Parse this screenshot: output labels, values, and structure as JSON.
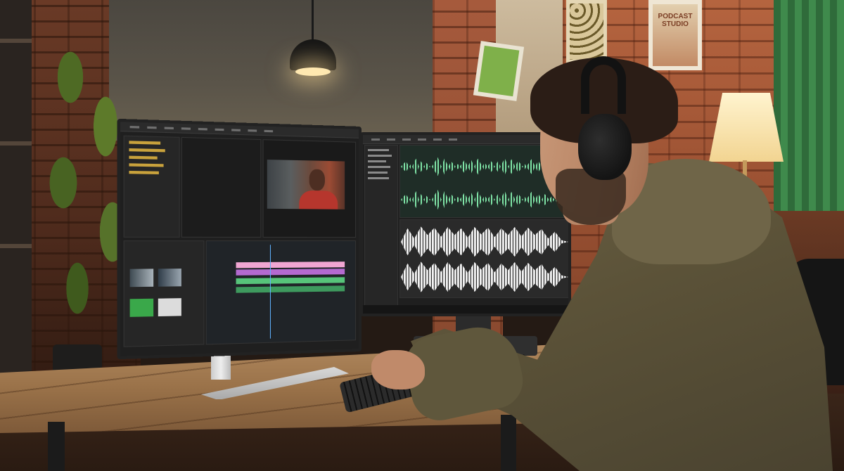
{
  "scene": {
    "poster_text": "PODCAST STUDIO",
    "palette": {
      "brick": "#a65a3c",
      "desk": "#9a7249",
      "hoodie": "#5b5238",
      "wave_green": "#7fe3a6",
      "wave_white": "#f2f2f2",
      "acoustic_panel": "#3f8a4c"
    },
    "icons": {
      "pendant_lamp": "pendant-lamp-icon",
      "floor_lamp": "table-lamp-icon",
      "headphones": "headphones-icon"
    }
  }
}
